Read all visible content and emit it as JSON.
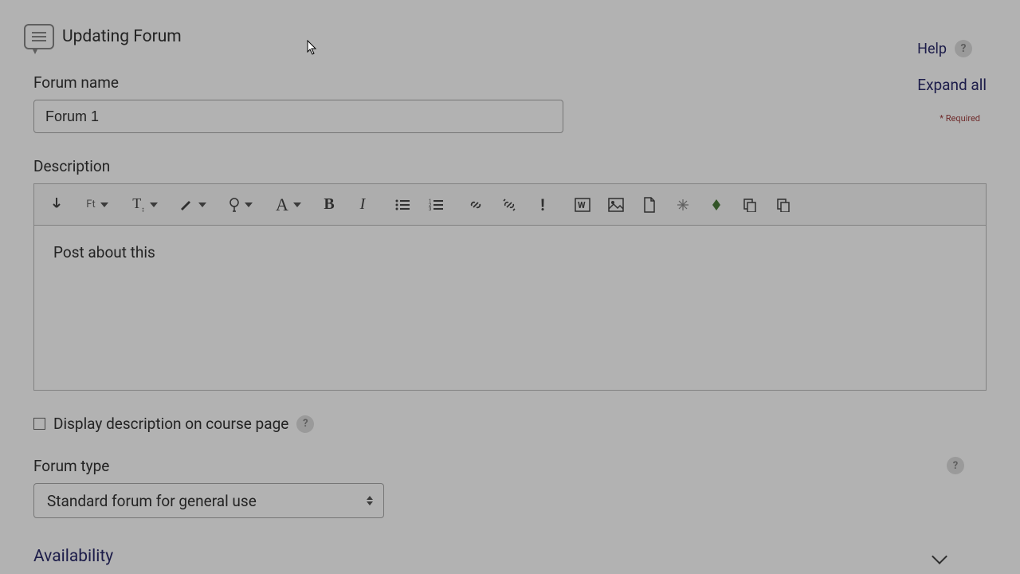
{
  "header": {
    "title": "Updating Forum",
    "help": "Help",
    "expand_all": "Expand all",
    "required": "Required"
  },
  "form": {
    "name_label": "Forum name",
    "name_value": "Forum 1",
    "desc_label": "Description",
    "desc_value": "Post about this",
    "display_desc_label": "Display description on course page",
    "type_label": "Forum type",
    "type_value": "Standard forum for general use"
  },
  "toolbar": {
    "font_label": "Ft",
    "size_label": "T₂"
  },
  "sections": {
    "availability": "Availability"
  }
}
